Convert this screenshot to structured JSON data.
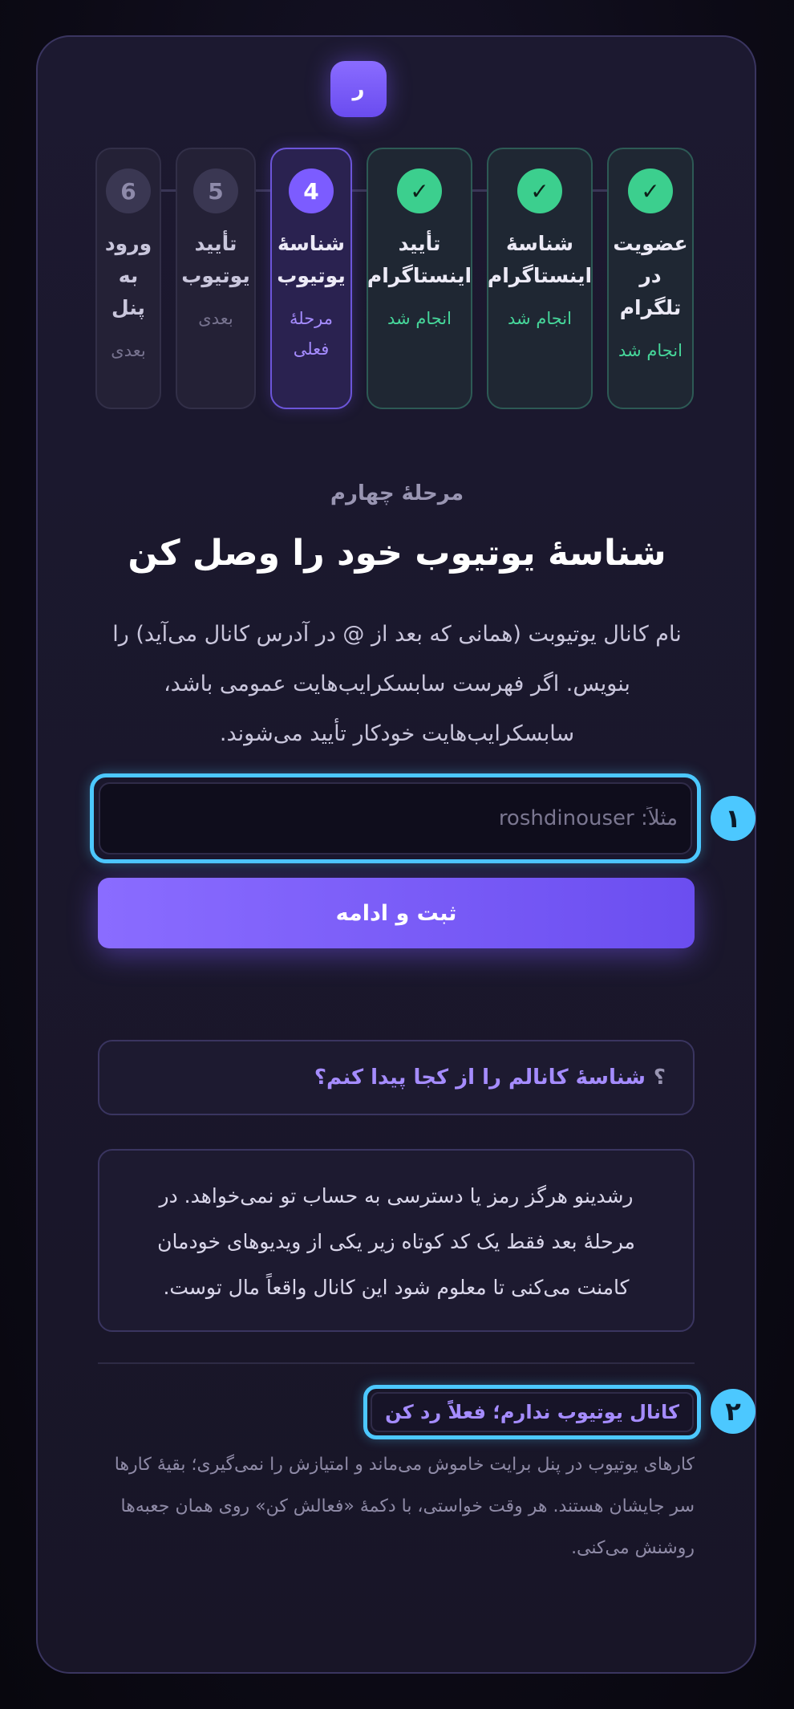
{
  "logo": {
    "letter": "ر"
  },
  "steps": [
    {
      "number": "",
      "icon": "check-icon",
      "title": "عضویت در تلگرام",
      "status": "انجام شد",
      "state": "done"
    },
    {
      "number": "",
      "icon": "check-icon",
      "title": "شناسهٔ اینستاگرام",
      "status": "انجام شد",
      "state": "done"
    },
    {
      "number": "",
      "icon": "check-icon",
      "title": "تأیید اینستاگرام",
      "status": "انجام شد",
      "state": "done"
    },
    {
      "number": "4",
      "title": "شناسهٔ یوتیوب",
      "status": "مرحلهٔ فعلی",
      "state": "current"
    },
    {
      "number": "5",
      "title": "تأیید یوتیوب",
      "status": "بعدی",
      "state": "next"
    },
    {
      "number": "6",
      "title": "ورود به پنل",
      "status": "بعدی",
      "state": "next"
    }
  ],
  "check_glyph": "✓",
  "main": {
    "stage_label": "مرحلهٔ چهارم",
    "title": "شناسهٔ یوتیوب خود را وصل کن",
    "description": "نام کانال یوتیوبت (همانی که بعد از @ در آدرس کانال می‌آید) را بنویس. اگر فهرست سابسکرایب‌هایت عمومی باشد، سابسکرایب‌هایت خودکار تأیید می‌شوند.",
    "input_placeholder": "مثلاً: roshdinouser",
    "input_value": "",
    "submit_label": "ثبت و ادامه"
  },
  "markers": {
    "first": "۱",
    "second": "۲"
  },
  "faq": {
    "question_mark": "؟",
    "label": "شناسهٔ کانالم را از کجا پیدا کنم؟"
  },
  "info": {
    "text": "رشدینو هرگز رمز یا دسترسی به حساب تو نمی‌خواهد. در مرحلهٔ بعد فقط یک کد کوتاه زیر یکی از ویدیوهای خودمان کامنت می‌کنی تا معلوم شود این کانال واقعاً مال توست."
  },
  "skip": {
    "label": "کانال یوتیوب ندارم؛ فعلاً رد کن",
    "note": "کارهای یوتیوب در پنل برایت خاموش می‌ماند و امتیازش را نمی‌گیری؛ بقیهٔ کارها سر جایشان هستند. هر وقت خواستی، با دکمهٔ «فعالش کن» روی همان جعبه‌ها روشنش می‌کنی."
  },
  "colors": {
    "accent": "#7c5cff",
    "done": "#3ccf8e",
    "highlight": "#4cc8ff",
    "background": "#0d0b17"
  }
}
